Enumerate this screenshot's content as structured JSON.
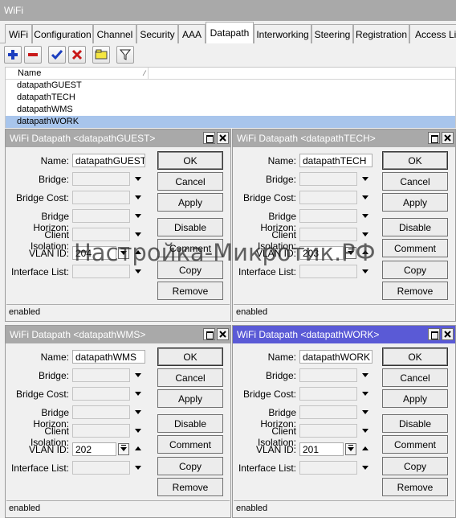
{
  "window": {
    "title": "WiFi"
  },
  "tabs": [
    {
      "label": "WiFi"
    },
    {
      "label": "Configuration"
    },
    {
      "label": "Channel"
    },
    {
      "label": "Security"
    },
    {
      "label": "AAA"
    },
    {
      "label": "Datapath",
      "active": true
    },
    {
      "label": "Interworking"
    },
    {
      "label": "Steering"
    },
    {
      "label": "Registration"
    },
    {
      "label": "Access Lis"
    }
  ],
  "toolbar": {
    "icons": [
      "add-icon",
      "remove-icon",
      "enable-icon",
      "disable-icon",
      "comment-icon",
      "filter-icon"
    ]
  },
  "list": {
    "column_name": "Name",
    "rows": [
      {
        "name": "datapathGUEST"
      },
      {
        "name": "datapathTECH"
      },
      {
        "name": "datapathWMS"
      },
      {
        "name": "datapathWORK",
        "selected": true
      }
    ]
  },
  "labels": {
    "name": "Name:",
    "bridge": "Bridge:",
    "bridge_cost": "Bridge Cost:",
    "bridge_horizon": "Bridge Horizon:",
    "client_isolation": "Client Isolation:",
    "vlan_id": "VLAN ID:",
    "interface_list": "Interface List:"
  },
  "buttons": {
    "ok": "OK",
    "cancel": "Cancel",
    "apply": "Apply",
    "disable": "Disable",
    "comment": "Comment",
    "copy": "Copy",
    "remove": "Remove"
  },
  "windows": [
    {
      "title": "WiFi Datapath <datapathGUEST>",
      "name": "datapathGUEST",
      "vlan_id": "204",
      "status": "enabled"
    },
    {
      "title": "WiFi Datapath <datapathTECH>",
      "name": "datapathTECH",
      "vlan_id": "203",
      "status": "enabled"
    },
    {
      "title": "WiFi Datapath <datapathWMS>",
      "name": "datapathWMS",
      "vlan_id": "202",
      "status": "enabled"
    },
    {
      "title": "WiFi Datapath <datapathWORK>",
      "name": "datapathWORK",
      "vlan_id": "201",
      "status": "enabled",
      "active": true
    }
  ],
  "watermark": "Настройка-Микротик.РФ"
}
